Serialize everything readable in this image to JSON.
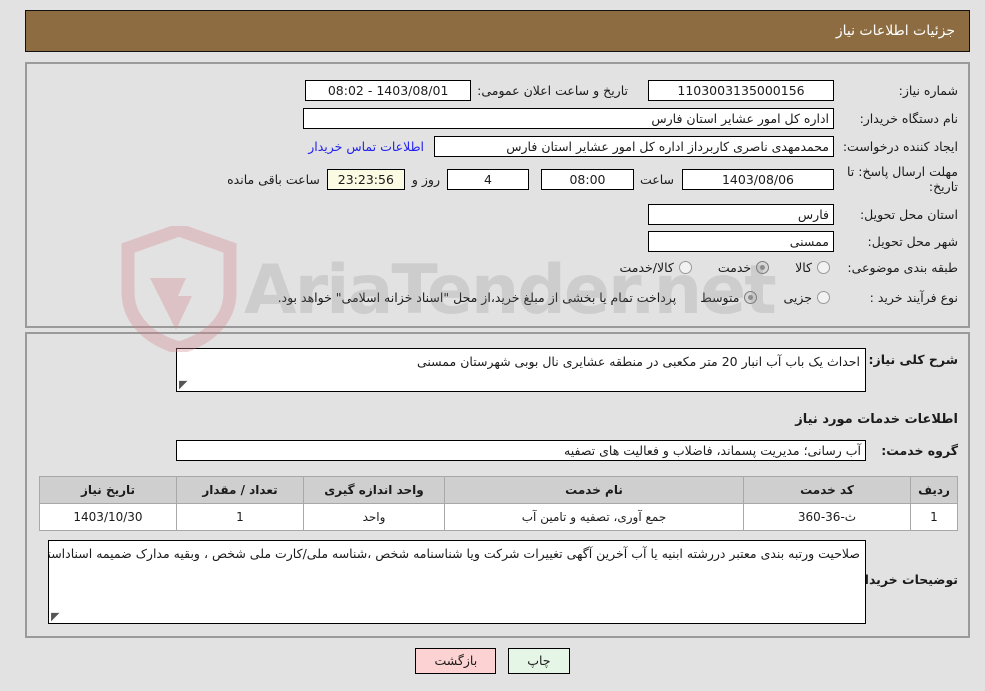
{
  "header": {
    "title": "جزئیات اطلاعات نیاز"
  },
  "top_section": {
    "need_number": {
      "label": "شماره نیاز:",
      "value": "1103003135000156"
    },
    "announce_datetime": {
      "label": "تاریخ و ساعت اعلان عمومی:",
      "value": "1403/08/01 - 08:02"
    },
    "buyer_org": {
      "label": "نام دستگاه خریدار:",
      "value": "اداره کل امور عشایر استان فارس"
    },
    "requester": {
      "label": "ایجاد کننده درخواست:",
      "value": "محمدمهدی ناصری کاربرداز اداره کل امور عشایر استان فارس"
    },
    "contact_link": {
      "label": "اطلاعات تماس خریدار"
    },
    "deadline": {
      "label": "مهلت ارسال پاسخ: تا تاریخ:",
      "date": "1403/08/06",
      "hour_label": "ساعت",
      "hour_value": "08:00",
      "days_value": "4",
      "days_label": "روز و",
      "timer_value": "23:23:56",
      "timer_label": "ساعت باقی مانده"
    },
    "delivery_province": {
      "label": "استان محل تحویل:",
      "value": "فارس"
    },
    "delivery_city": {
      "label": "شهر محل تحویل:",
      "value": "ممسنی"
    },
    "subject_category": {
      "label": "طبقه بندی موضوعی:",
      "options": [
        {
          "label": "کالا",
          "selected": false
        },
        {
          "label": "خدمت",
          "selected": true
        },
        {
          "label": "کالا/خدمت",
          "selected": false
        }
      ]
    },
    "purchase_process": {
      "label": "نوع فرآیند خرید :",
      "options": [
        {
          "label": "جزیی",
          "selected": false
        },
        {
          "label": "متوسط",
          "selected": true
        }
      ],
      "note": "پرداخت تمام یا بخشی از مبلغ خرید،از محل \"اسناد خزانه اسلامی\" خواهد بود."
    }
  },
  "bottom_section": {
    "general_desc": {
      "label": "شرح کلی نیاز:",
      "value": "احداث یک باب آب انبار 20 متر مکعبی در منطقه عشایری نال بوبی شهرستان ممسنی"
    },
    "services_heading": "اطلاعات خدمات مورد نیاز",
    "service_group": {
      "label": "گروه خدمت:",
      "value": "آب رسانی؛ مدیریت پسماند، فاضلاب و فعالیت های تصفیه"
    },
    "table": {
      "columns": [
        "ردیف",
        "کد خدمت",
        "نام خدمت",
        "واحد اندازه گیری",
        "تعداد / مقدار",
        "تاریخ نیاز"
      ],
      "rows": [
        [
          "1",
          "ث-36-360",
          "جمع آوری، تصفیه و تامین آب",
          "واحد",
          "1",
          "1403/10/30"
        ]
      ]
    },
    "buyer_notes": {
      "label": "توضیحات خریدار:",
      "value": "صلاحیت ورتبه بندی معتبر دررشته  ابنیه یا آب  آخرین آگهی تغییرات شرکت ویا شناسنامه شخص ،شناسه ملی/کارت ملی شخص ، وبقیه مدارک  ضمیمه اسناداستعلام گردد"
    }
  },
  "footer": {
    "print_label": "چاپ",
    "back_label": "بازگشت"
  },
  "watermark": {
    "text": "AriaTender.net"
  },
  "colors": {
    "header_brown": "#8c6c40",
    "page_bg": "#e2e2e2",
    "link_blue": "#2222ee",
    "timer_bg": "#fbfae3",
    "back_btn_bg": "#fdd2d2",
    "print_btn_bg": "#e6f6e6"
  }
}
